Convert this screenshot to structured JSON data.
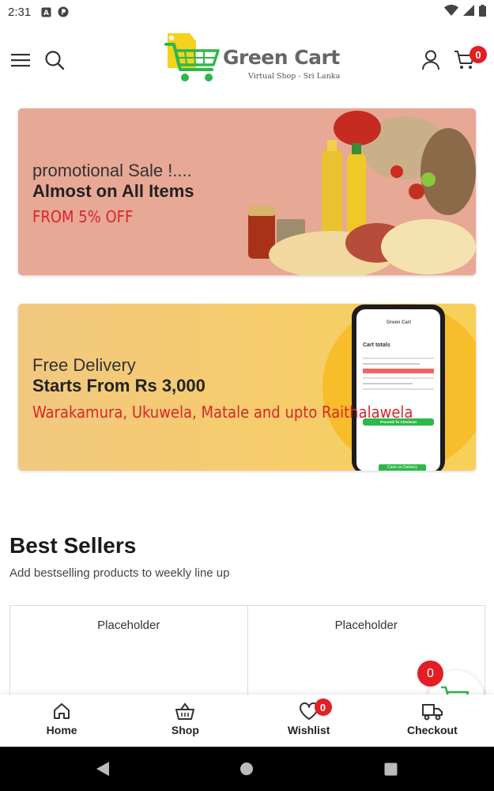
{
  "status_bar": {
    "time": "2:31"
  },
  "header": {
    "logo_title": "Green Cart",
    "logo_subtitle": "Virtual Shop - Sri Lanka",
    "cart_count": "0"
  },
  "banners": [
    {
      "line1": "promotional Sale !....",
      "line2": "Almost on All Items",
      "line3": "FROM 5% OFF",
      "bg_color": "#e8a896"
    },
    {
      "line1": "Free Delivery",
      "line2": "Starts From Rs 3,000",
      "line3": "Warakamura, Ukuwela, Matale and upto Raithalawela",
      "bg_color": "#f6cd6a",
      "phone": {
        "logo": "Green Cart",
        "heading": "Cart totals",
        "button": "Proceed To Checkout",
        "cod": "Cash on Delivery"
      }
    }
  ],
  "best_sellers": {
    "title": "Best Sellers",
    "subtitle": "Add bestselling products to weekly line up",
    "products": [
      "Placeholder",
      "Placeholder"
    ]
  },
  "floating_cart": {
    "count": "0"
  },
  "bottom_nav": {
    "items": [
      {
        "label": "Home",
        "icon": "home-icon"
      },
      {
        "label": "Shop",
        "icon": "basket-icon"
      },
      {
        "label": "Wishlist",
        "icon": "heart-icon",
        "badge": "0"
      },
      {
        "label": "Checkout",
        "icon": "truck-icon"
      }
    ]
  },
  "colors": {
    "brand_green": "#2db84b",
    "badge_red": "#e31e24",
    "accent_red": "#d7262a"
  }
}
